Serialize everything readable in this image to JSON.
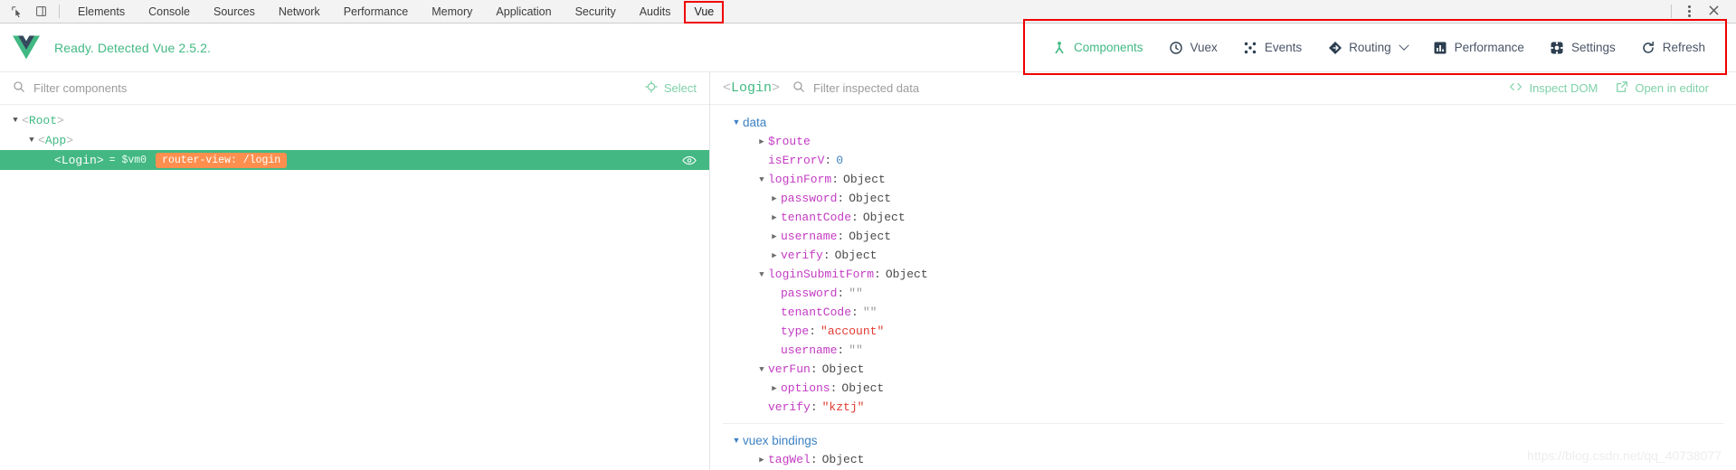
{
  "devtools": {
    "icons": {
      "inspect": "inspect-element-icon",
      "device": "device-toolbar-icon"
    },
    "tabs": [
      {
        "label": "Elements",
        "active": false
      },
      {
        "label": "Console",
        "active": false
      },
      {
        "label": "Sources",
        "active": false
      },
      {
        "label": "Network",
        "active": false
      },
      {
        "label": "Performance",
        "active": false
      },
      {
        "label": "Memory",
        "active": false
      },
      {
        "label": "Application",
        "active": false
      },
      {
        "label": "Security",
        "active": false
      },
      {
        "label": "Audits",
        "active": false
      },
      {
        "label": "Vue",
        "active": true,
        "highlighted": true
      }
    ],
    "more_label": "more-options",
    "close_label": "✕"
  },
  "vue_header": {
    "status": "Ready. Detected Vue 2.5.2.",
    "logo": "vue-logo",
    "actions": [
      {
        "label": "Components",
        "icon": "components-tree-icon",
        "active": true,
        "chevron": false
      },
      {
        "label": "Vuex",
        "icon": "vuex-clock-icon",
        "active": false,
        "chevron": false
      },
      {
        "label": "Events",
        "icon": "events-dots-icon",
        "active": false,
        "chevron": false
      },
      {
        "label": "Routing",
        "icon": "routing-compass-icon",
        "active": false,
        "chevron": true
      },
      {
        "label": "Performance",
        "icon": "performance-bars-icon",
        "active": false,
        "chevron": false
      },
      {
        "label": "Settings",
        "icon": "settings-gear-icon",
        "active": false,
        "chevron": false
      },
      {
        "label": "Refresh",
        "icon": "refresh-icon",
        "active": false,
        "chevron": false
      }
    ]
  },
  "left_pane": {
    "filter_placeholder": "Filter components",
    "filter_value": "",
    "search_icon": "search-icon",
    "select_button": {
      "label": "Select",
      "icon": "target-crosshair-icon"
    },
    "tree": [
      {
        "depth": 0,
        "arrow": "down",
        "tag": "Root",
        "selected": false,
        "vm": "",
        "badge": ""
      },
      {
        "depth": 1,
        "arrow": "down",
        "tag": "App",
        "selected": false,
        "vm": "",
        "badge": ""
      },
      {
        "depth": 2,
        "arrow": "none",
        "tag": "Login",
        "selected": true,
        "vm": "= $vm0",
        "badge": "router-view: /login"
      }
    ]
  },
  "right_pane": {
    "inspected_component": "Login",
    "filter_placeholder": "Filter inspected data",
    "filter_value": "",
    "search_icon": "search-icon",
    "inspect_dom": {
      "label": "Inspect DOM",
      "icon": "code-brackets-icon"
    },
    "open_in_editor": {
      "label": "Open in editor",
      "icon": "external-link-icon"
    },
    "sections": [
      {
        "title": "data",
        "rows": [
          {
            "indent": 1,
            "arrow": "right",
            "key": "$route",
            "sep": "",
            "value": "",
            "type": "none"
          },
          {
            "indent": 1,
            "arrow": "none",
            "key": "isErrorV",
            "sep": ":",
            "value": "0",
            "type": "num"
          },
          {
            "indent": 1,
            "arrow": "down",
            "key": "loginForm",
            "sep": ":",
            "value": "Object",
            "type": "obj"
          },
          {
            "indent": 2,
            "arrow": "right",
            "key": "password",
            "sep": ":",
            "value": "Object",
            "type": "obj"
          },
          {
            "indent": 2,
            "arrow": "right",
            "key": "tenantCode",
            "sep": ":",
            "value": "Object",
            "type": "obj"
          },
          {
            "indent": 2,
            "arrow": "right",
            "key": "username",
            "sep": ":",
            "value": "Object",
            "type": "obj"
          },
          {
            "indent": 2,
            "arrow": "right",
            "key": "verify",
            "sep": ":",
            "value": "Object",
            "type": "obj"
          },
          {
            "indent": 1,
            "arrow": "down",
            "key": "loginSubmitForm",
            "sep": ":",
            "value": "Object",
            "type": "obj"
          },
          {
            "indent": 2,
            "arrow": "none",
            "key": "password",
            "sep": ":",
            "value": "\"\"",
            "type": "empty"
          },
          {
            "indent": 2,
            "arrow": "none",
            "key": "tenantCode",
            "sep": ":",
            "value": "\"\"",
            "type": "empty"
          },
          {
            "indent": 2,
            "arrow": "none",
            "key": "type",
            "sep": ":",
            "value": "\"account\"",
            "type": "str"
          },
          {
            "indent": 2,
            "arrow": "none",
            "key": "username",
            "sep": ":",
            "value": "\"\"",
            "type": "empty"
          },
          {
            "indent": 1,
            "arrow": "down",
            "key": "verFun",
            "sep": ":",
            "value": "Object",
            "type": "obj"
          },
          {
            "indent": 2,
            "arrow": "right",
            "key": "options",
            "sep": ":",
            "value": "Object",
            "type": "obj"
          },
          {
            "indent": 2,
            "arrow": "none",
            "key": "verify",
            "sep": ":",
            "value": "\"kztj\"",
            "type": "str"
          }
        ]
      },
      {
        "title": "vuex bindings",
        "rows": [
          {
            "indent": 1,
            "arrow": "right",
            "key": "tagWel",
            "sep": ":",
            "value": "Object",
            "type": "obj"
          }
        ]
      }
    ]
  },
  "watermark": "https://blog.csdn.net/qq_40738077"
}
